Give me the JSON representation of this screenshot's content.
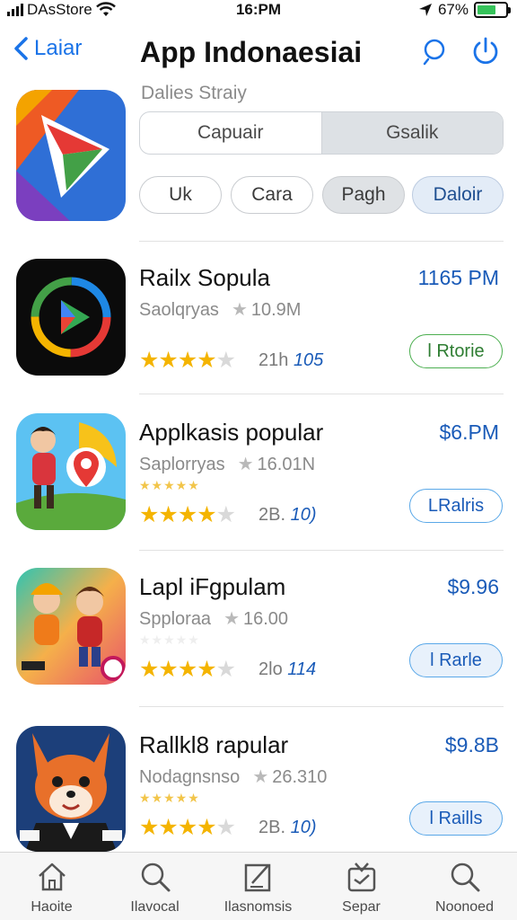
{
  "status_bar": {
    "carrier": "DAsStore",
    "time": "16:PM",
    "battery": "67%"
  },
  "nav": {
    "back_label": "Laiar",
    "title": "App Indonaesiai",
    "icons": [
      "search-icon",
      "power-icon"
    ]
  },
  "header": {
    "subtitle": "Dalies Straiy",
    "segments": [
      "Capuair",
      "Gsalik"
    ],
    "selected_segment": 1,
    "chips": [
      "Uk",
      "Cara",
      "Pagh",
      "Daloir"
    ]
  },
  "apps": [
    {
      "name": "Railx Sopula",
      "developer": "Saolqryas",
      "size": "10.9M",
      "faint_stars": "",
      "rating": 4,
      "meta_prefix": "21h",
      "meta_count": "105",
      "price": "1165 PM",
      "action": "l Rtorie",
      "icon": "play-ring-icon"
    },
    {
      "name": "Applkasis popular",
      "developer": "Saplorryas",
      "size": "16.01N",
      "faint_stars": "★★★★★",
      "rating": 4,
      "meta_prefix": "2B.",
      "meta_count": "10)",
      "price": "$6.PM",
      "action": "LRalris",
      "icon": "map-pin-character-icon"
    },
    {
      "name": "Lapl iFgpulam",
      "developer": "Spploraa",
      "size": "16.00",
      "faint_stars": "★★★★★",
      "rating": 4,
      "meta_prefix": "2lo",
      "meta_count": "114",
      "price": "$9.96",
      "action": "l Rarle",
      "icon": "kids-characters-icon"
    },
    {
      "name": "Rallkl8 rapular",
      "developer": "Nodagnsnso",
      "size": "26.310",
      "faint_stars": "★★★★★",
      "rating": 4,
      "meta_prefix": "2B.",
      "meta_count": "10)",
      "price": "$9.8B",
      "action": "l Raills",
      "icon": "fox-character-icon"
    }
  ],
  "tabs": [
    {
      "label": "Haoite",
      "icon": "home-icon"
    },
    {
      "label": "Ilavocal",
      "icon": "search-icon"
    },
    {
      "label": "Ilasnomsis",
      "icon": "edit-icon"
    },
    {
      "label": "Separ",
      "icon": "inbox-icon"
    },
    {
      "label": "Noonoed",
      "icon": "search-icon"
    }
  ],
  "colors": {
    "accent": "#1a5bb8",
    "link": "#1a73e8",
    "star": "#f4b400",
    "battery": "#35c35a"
  }
}
